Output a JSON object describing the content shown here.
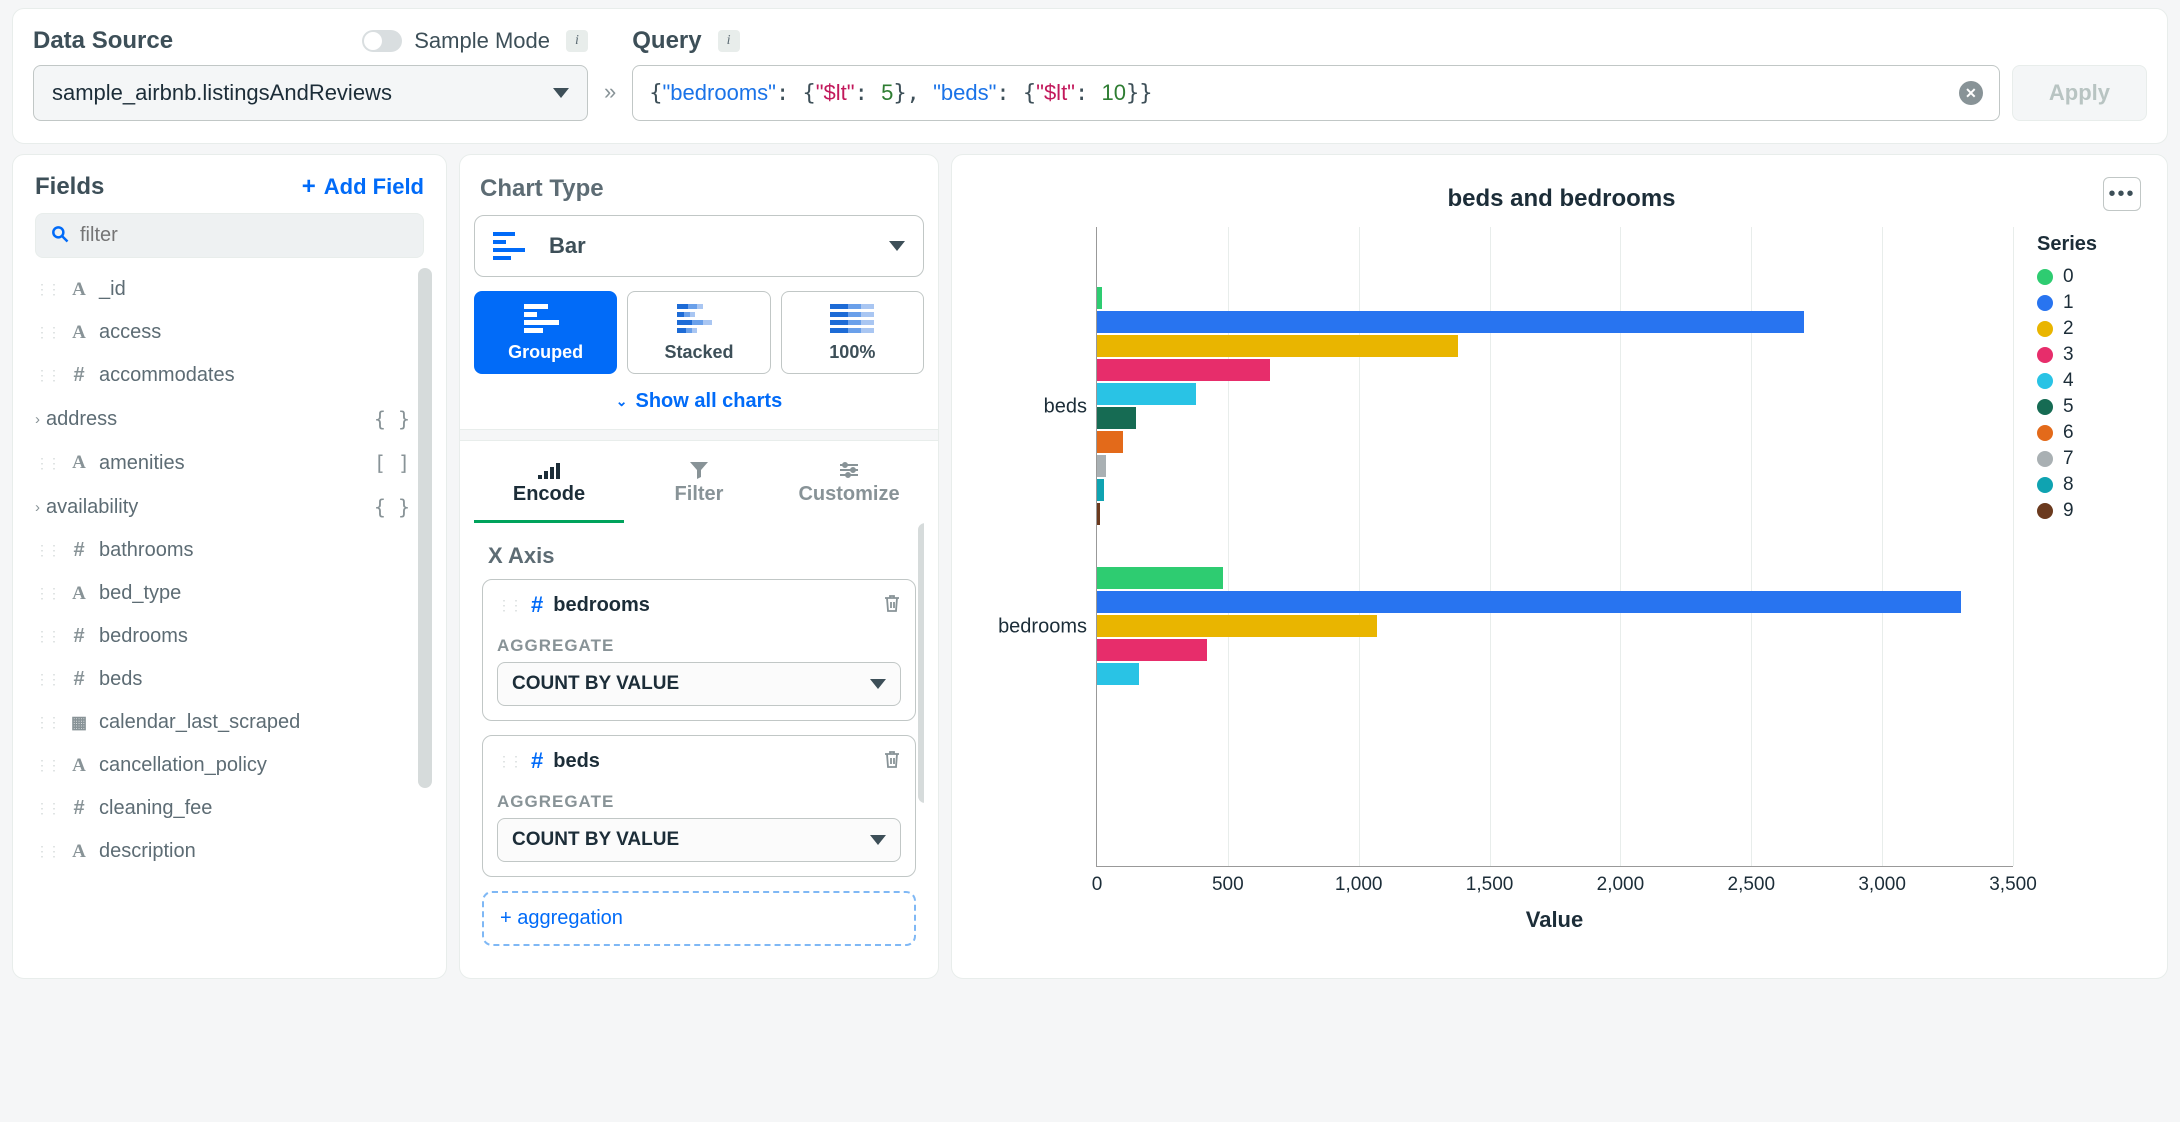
{
  "topbar": {
    "data_source_label": "Data Source",
    "sample_mode_label": "Sample Mode",
    "data_source_value": "sample_airbnb.listingsAndReviews",
    "query_label": "Query",
    "query_value_html": "{\"bedrooms\": {\"$lt\": 5}, \"beds\": {\"$lt\": 10}}",
    "apply_label": "Apply"
  },
  "fields_panel": {
    "title": "Fields",
    "add_field": "Add Field",
    "filter_placeholder": "filter",
    "items": [
      {
        "name": "_id",
        "type": "A"
      },
      {
        "name": "access",
        "type": "A"
      },
      {
        "name": "accommodates",
        "type": "#"
      },
      {
        "name": "address",
        "type": ">",
        "suffix": "{ }"
      },
      {
        "name": "amenities",
        "type": "A",
        "suffix": "[ ]"
      },
      {
        "name": "availability",
        "type": ">",
        "suffix": "{ }"
      },
      {
        "name": "bathrooms",
        "type": "#"
      },
      {
        "name": "bed_type",
        "type": "A"
      },
      {
        "name": "bedrooms",
        "type": "#"
      },
      {
        "name": "beds",
        "type": "#"
      },
      {
        "name": "calendar_last_scraped",
        "type": "cal"
      },
      {
        "name": "cancellation_policy",
        "type": "A"
      },
      {
        "name": "cleaning_fee",
        "type": "#"
      },
      {
        "name": "description",
        "type": "A"
      }
    ]
  },
  "config_panel": {
    "chart_type_label": "Chart Type",
    "chart_type_value": "Bar",
    "subtypes": [
      "Grouped",
      "Stacked",
      "100%"
    ],
    "subtype_active": "Grouped",
    "show_all": "Show all charts",
    "tabs": [
      "Encode",
      "Filter",
      "Customize"
    ],
    "tab_active": "Encode",
    "x_axis_label": "X Axis",
    "aggregate_label": "AGGREGATE",
    "encodings": [
      {
        "field": "bedrooms",
        "aggregate": "COUNT BY VALUE"
      },
      {
        "field": "beds",
        "aggregate": "COUNT BY VALUE"
      }
    ],
    "add_aggregation": "+ aggregation"
  },
  "chart": {
    "title": "beds and bedrooms",
    "x_axis_title": "Value",
    "legend_title": "Series"
  },
  "chart_data": {
    "type": "bar",
    "orientation": "horizontal",
    "grouped": true,
    "xlabel": "Value",
    "ylabel": "",
    "xlim": [
      0,
      3500
    ],
    "xticks": [
      0,
      500,
      1000,
      1500,
      2000,
      2500,
      3000,
      3500
    ],
    "categories": [
      "beds",
      "bedrooms"
    ],
    "series": [
      {
        "name": "0",
        "color": "#2ecc71",
        "values": [
          20,
          480
        ]
      },
      {
        "name": "1",
        "color": "#2874f0",
        "values": [
          2700,
          3300
        ]
      },
      {
        "name": "2",
        "color": "#e9b500",
        "values": [
          1380,
          1070
        ]
      },
      {
        "name": "3",
        "color": "#e72d6b",
        "values": [
          660,
          420
        ]
      },
      {
        "name": "4",
        "color": "#29c3e5",
        "values": [
          380,
          160
        ]
      },
      {
        "name": "5",
        "color": "#166b53",
        "values": [
          150,
          0
        ]
      },
      {
        "name": "6",
        "color": "#e36a1a",
        "values": [
          100,
          0
        ]
      },
      {
        "name": "7",
        "color": "#a9b0b3",
        "values": [
          35,
          0
        ]
      },
      {
        "name": "8",
        "color": "#0fa3b1",
        "values": [
          25,
          0
        ]
      },
      {
        "name": "9",
        "color": "#6b3a1e",
        "values": [
          10,
          0
        ]
      }
    ]
  }
}
